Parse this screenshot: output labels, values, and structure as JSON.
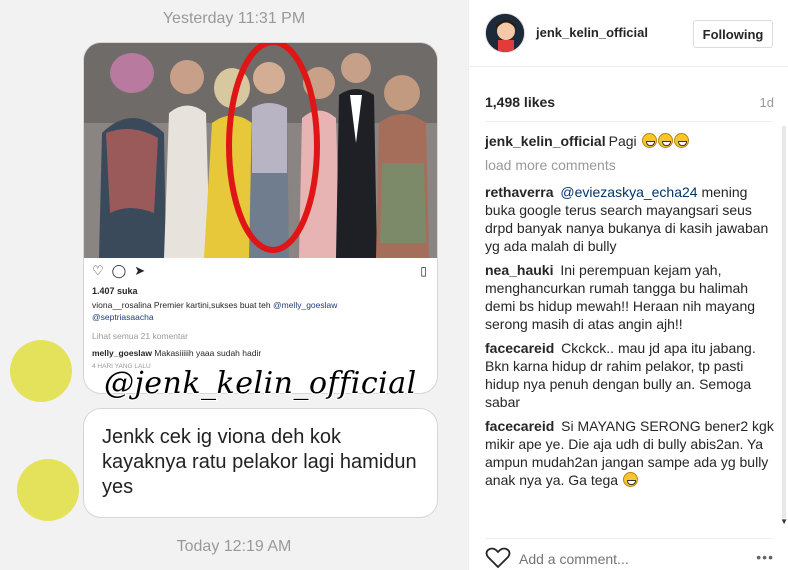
{
  "chat": {
    "timestamp_top": "Yesterday 11:31 PM",
    "timestamp_bottom": "Today 12:19 AM",
    "shared_post": {
      "likes": "1.407 suka",
      "caption_user": "viona__rosalina",
      "caption_text": "Premier kartini,sukses buat teh",
      "caption_tag1": "@melly_goeslaw",
      "caption_tag2": "@septriasaacha",
      "view_all": "Lihat semua 21 komentar",
      "comment_user": "melly_goeslaw",
      "comment_text": "Makasiiiiih yaaa sudah hadir",
      "time_ago": "4 HARI YANG LALU"
    },
    "watermark": "@jenk_kelin_official",
    "message": "Jenkk cek ig viona deh kok kayaknya ratu pelakor lagi hamidun yes"
  },
  "instagram": {
    "username": "jenk_kelin_official",
    "follow_label": "Following",
    "likes": "1,498 likes",
    "age": "1d",
    "caption": {
      "user": "jenk_kelin_official",
      "text": "Pagi"
    },
    "load_more": "load more comments",
    "comments": [
      {
        "user": "rethaverra",
        "mention": "@eviezaskya_echa24",
        "text": "mening buka google terus search mayangsari seus drpd banyak nanya bukanya di kasih jawaban yg ada malah di bully"
      },
      {
        "user": "nea_hauki",
        "mention": "",
        "text": "Ini perempuan kejam yah, menghancurkan rumah tangga bu halimah demi bs hidup mewah!! Heraan nih mayang serong masih di atas angin ajh!!"
      },
      {
        "user": "facecareid",
        "mention": "",
        "text": "Ckckck.. mau jd apa itu jabang. Bkn karna hidup dr rahim pelakor, tp pasti hidup nya penuh dengan bully an. Semoga sabar"
      },
      {
        "user": "facecareid",
        "mention": "",
        "text": "Si MAYANG SERONG bener2 kgk mikir ape ye. Die aja udh di bully abis2an. Ya ampun mudah2an jangan sampe ada yg bully anak nya ya. Ga tega"
      }
    ],
    "add_comment_placeholder": "Add a comment...",
    "more_label": "•••",
    "icons": [
      "heart-icon",
      "more-options-icon",
      "bookmark-icon",
      "comment-icon",
      "share-icon"
    ]
  }
}
